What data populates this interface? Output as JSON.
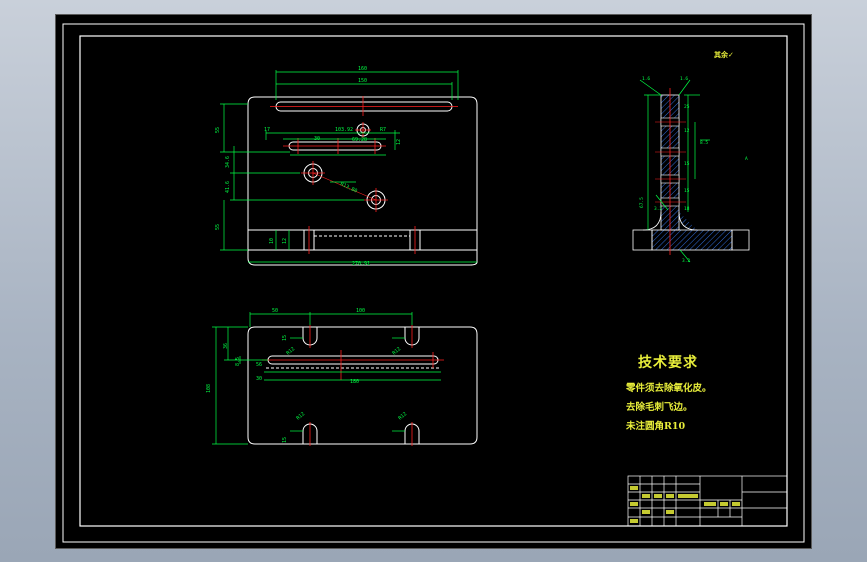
{
  "technical_requirements": {
    "title": "技术要求",
    "lines": [
      "零件须去除氧化皮。",
      "去除毛刺飞边。",
      "未注圆角R10"
    ]
  },
  "roughness_note": "其余",
  "colors": {
    "background": "#000000",
    "outline": "#ffffff",
    "dimension": "#00ff44",
    "center_line": "#ff2020",
    "hatch": "#2f6bd8",
    "annotation": "#e8ee3a",
    "frame": "#ffffff"
  }
}
